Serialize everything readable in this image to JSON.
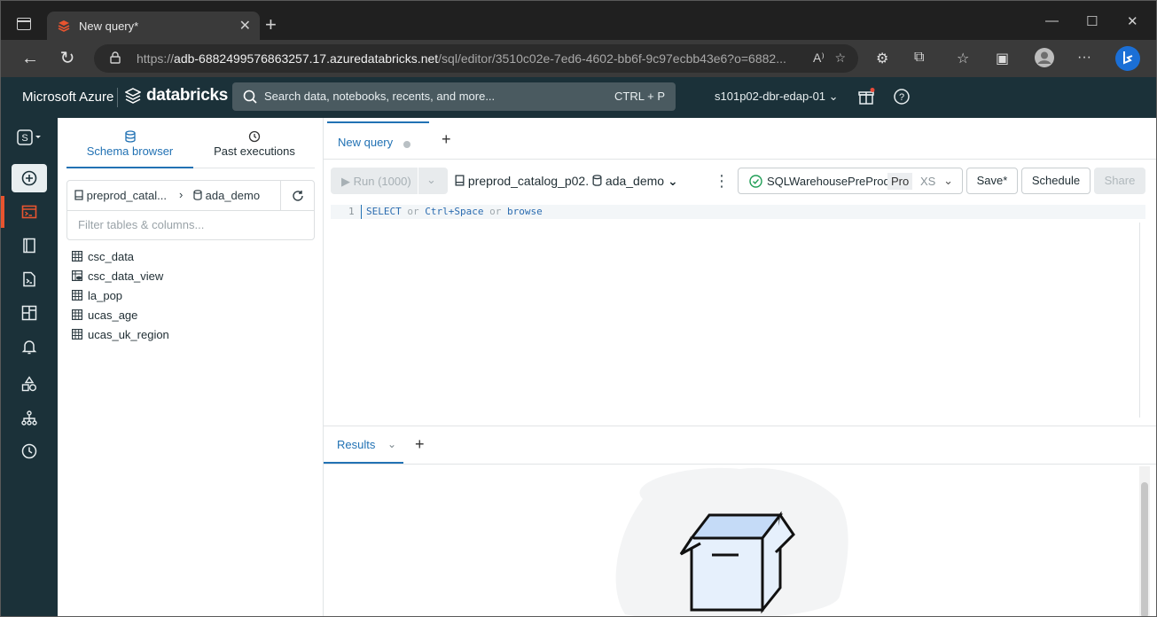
{
  "browser": {
    "tab_title": "New query*",
    "url_prefix": "https://",
    "url_host": "adb-6882499576863257.17.azuredatabricks.net",
    "url_path": "/sql/editor/3510c02e-7ed6-4602-bb6f-9c97ecbb43e6?o=6882..."
  },
  "header": {
    "ms_brand": "Microsoft Azure",
    "product": "databricks",
    "search_placeholder": "Search data, notebooks, recents, and more...",
    "search_shortcut": "CTRL + P",
    "workspace": "s101p02-dbr-edap-01"
  },
  "schema_panel": {
    "tabs": [
      {
        "label": "Schema browser",
        "active": true
      },
      {
        "label": "Past executions",
        "active": false
      }
    ],
    "catalog": "preprod_catal...",
    "schema": "ada_demo",
    "filter_placeholder": "Filter tables & columns...",
    "tables": [
      {
        "name": "csc_data",
        "kind": "table"
      },
      {
        "name": "csc_data_view",
        "kind": "view"
      },
      {
        "name": "la_pop",
        "kind": "table"
      },
      {
        "name": "ucas_age",
        "kind": "table"
      },
      {
        "name": "ucas_uk_region",
        "kind": "table"
      }
    ]
  },
  "editor": {
    "query_tab": "New query",
    "run_label": "Run (1000)",
    "catalog": "preprod_catalog_p02.",
    "schema": "ada_demo",
    "warehouse": "SQLWarehousePreProd",
    "warehouse_tier": "Pro",
    "warehouse_size": "XS",
    "save_label": "Save*",
    "schedule_label": "Schedule",
    "share_label": "Share",
    "line_number": "1",
    "code_kw1": "SELECT",
    "code_or1": " or ",
    "code_kw2": "Ctrl+Space",
    "code_or2": " or ",
    "code_kw3": "browse"
  },
  "results": {
    "tab_label": "Results"
  },
  "colors": {
    "accent": "#2272b4",
    "header_bg": "#1b3139",
    "active_rail": "#e8542f"
  }
}
